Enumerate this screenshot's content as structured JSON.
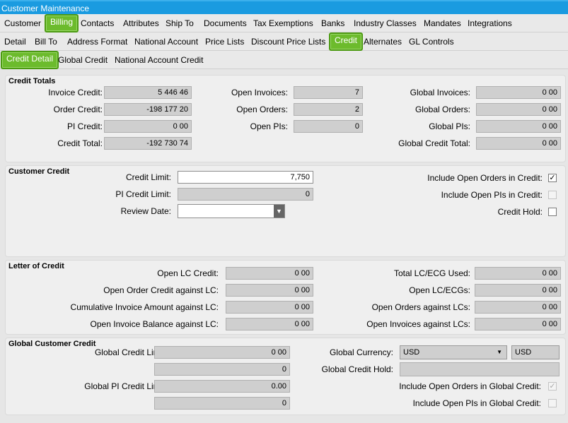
{
  "window": {
    "title": "Customer Maintenance"
  },
  "tabs_main": [
    "Customer",
    "Billing",
    "Contacts",
    "Attributes",
    "Ship To",
    "Documents",
    "Tax Exemptions",
    "Banks",
    "Industry Classes",
    "Mandates",
    "Integrations"
  ],
  "tabs_billing": [
    "Detail",
    "Bill To",
    "Address Format",
    "National Account",
    "Price Lists",
    "Discount Price Lists",
    "Credit",
    "Alternates",
    "GL Controls"
  ],
  "tabs_credit": [
    "Credit Detail",
    "Global Credit",
    "National Account Credit"
  ],
  "credit_totals": {
    "title": "Credit Totals",
    "invoice_credit_label": "Invoice Credit:",
    "invoice_credit": "5 446 46",
    "order_credit_label": "Order Credit:",
    "order_credit": "-198 177 20",
    "pi_credit_label": "PI Credit:",
    "pi_credit": "0 00",
    "credit_total_label": "Credit Total:",
    "credit_total": "-192 730 74",
    "open_invoices_label": "Open Invoices:",
    "open_invoices": "7",
    "open_orders_label": "Open Orders:",
    "open_orders": "2",
    "open_pis_label": "Open PIs:",
    "open_pis": "0",
    "global_invoices_label": "Global Invoices:",
    "global_invoices": "0 00",
    "global_orders_label": "Global Orders:",
    "global_orders": "0 00",
    "global_pis_label": "Global PIs:",
    "global_pis": "0 00",
    "global_credit_total_label": "Global Credit Total:",
    "global_credit_total": "0 00"
  },
  "customer_credit": {
    "title": "Customer Credit",
    "credit_limit_label": "Credit Limit:",
    "credit_limit": "7,750",
    "pi_credit_limit_label": "PI Credit Limit:",
    "pi_credit_limit": "0",
    "review_date_label": "Review Date:",
    "review_date": "",
    "include_open_orders_label": "Include Open Orders in Credit:",
    "include_open_orders": true,
    "include_open_pis_label": "Include Open PIs in Credit:",
    "include_open_pis": false,
    "credit_hold_label": "Credit Hold:",
    "credit_hold": false
  },
  "letter_of_credit": {
    "title": "Letter of Credit",
    "open_lc_credit_label": "Open LC Credit:",
    "open_lc_credit": "0 00",
    "open_order_credit_label": "Open Order Credit against LC:",
    "open_order_credit": "0 00",
    "cumulative_invoice_label": "Cumulative Invoice Amount against LC:",
    "cumulative_invoice": "0 00",
    "open_invoice_balance_label": "Open Invoice Balance against LC:",
    "open_invoice_balance": "0 00",
    "total_lc_ecg_label": "Total LC/ECG Used:",
    "total_lc_ecg": "0 00",
    "open_lc_ecgs_label": "Open LC/ECGs:",
    "open_lc_ecgs": "0 00",
    "open_orders_lcs_label": "Open Orders against LCs:",
    "open_orders_lcs": "0 00",
    "open_invoices_lcs_label": "Open Invoices against LCs:",
    "open_invoices_lcs": "0 00"
  },
  "global_customer_credit": {
    "title": "Global Customer Credit",
    "global_credit_limit_label": "Global Credit Limit:",
    "global_credit_limit": "0 00",
    "global_credit_limit_2": "0",
    "global_pi_credit_limit_label": "Global PI Credit Limit:",
    "global_pi_credit_limit": "0.00",
    "global_pi_credit_limit_2": "0",
    "global_currency_label": "Global Currency:",
    "global_currency": "USD",
    "global_currency_code": "USD",
    "global_credit_hold_label": "Global Credit Hold:",
    "global_credit_hold": "",
    "include_open_orders_global_label": "Include Open Orders in Global Credit:",
    "include_open_orders_global": true,
    "include_open_pis_global_label": "Include Open PIs in Global Credit:",
    "include_open_pis_global": false
  }
}
